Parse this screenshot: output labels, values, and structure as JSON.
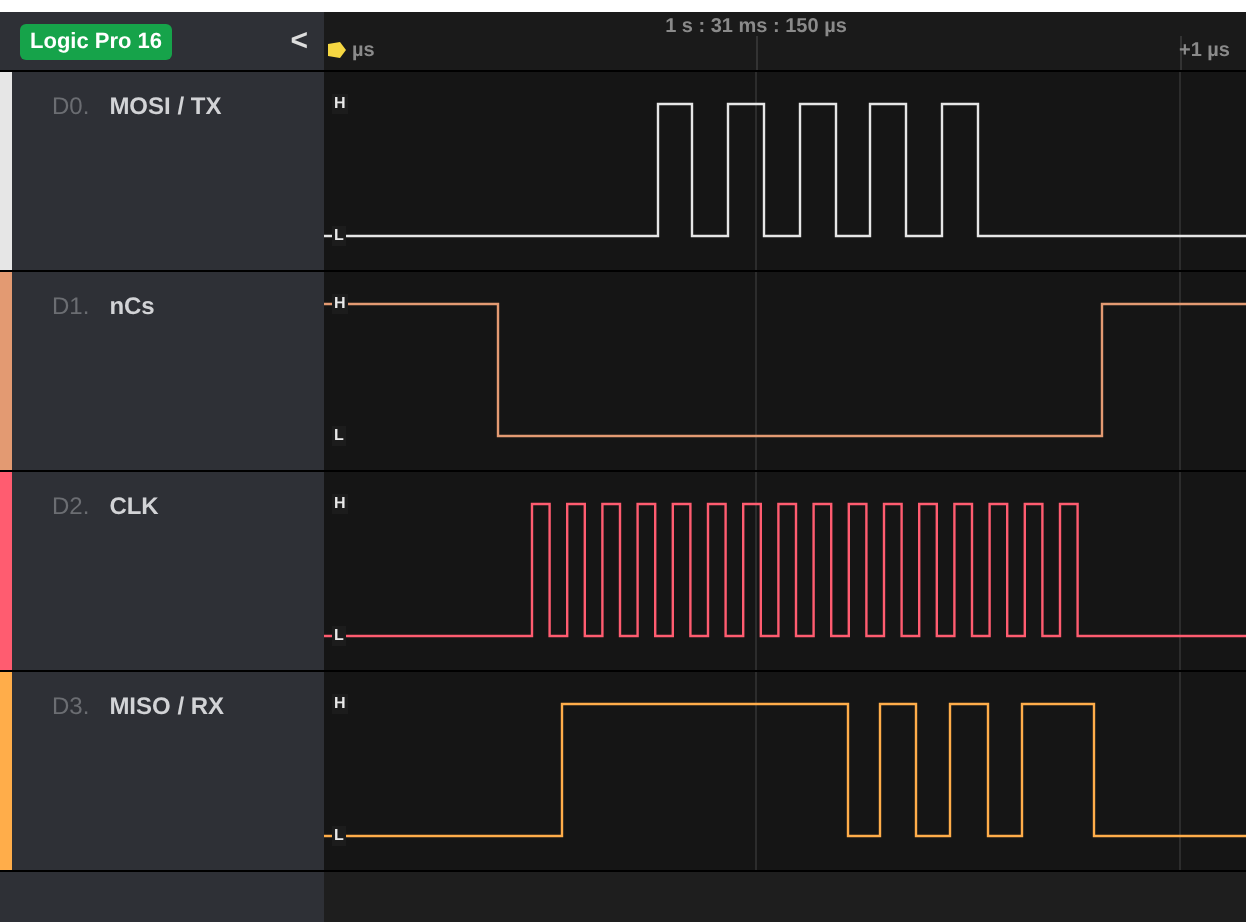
{
  "device": {
    "badge": "Logic Pro 16",
    "collapse": "<"
  },
  "ruler": {
    "start": "µs",
    "cursor": "1 s : 31 ms : 150 µs",
    "end": "+1 µs"
  },
  "channels": [
    {
      "index": "D0.",
      "name": "MOSI / TX",
      "color": "#e6e6e6",
      "high_label": "H",
      "low_label": "L"
    },
    {
      "index": "D1.",
      "name": "nCs",
      "color": "#e39a72",
      "high_label": "H",
      "low_label": "L"
    },
    {
      "index": "D2.",
      "name": "CLK",
      "color": "#ff5c70",
      "high_label": "H",
      "low_label": "L"
    },
    {
      "index": "D3.",
      "name": "MISO / RX",
      "color": "#ffad4a",
      "high_label": "H",
      "low_label": "L"
    }
  ]
}
